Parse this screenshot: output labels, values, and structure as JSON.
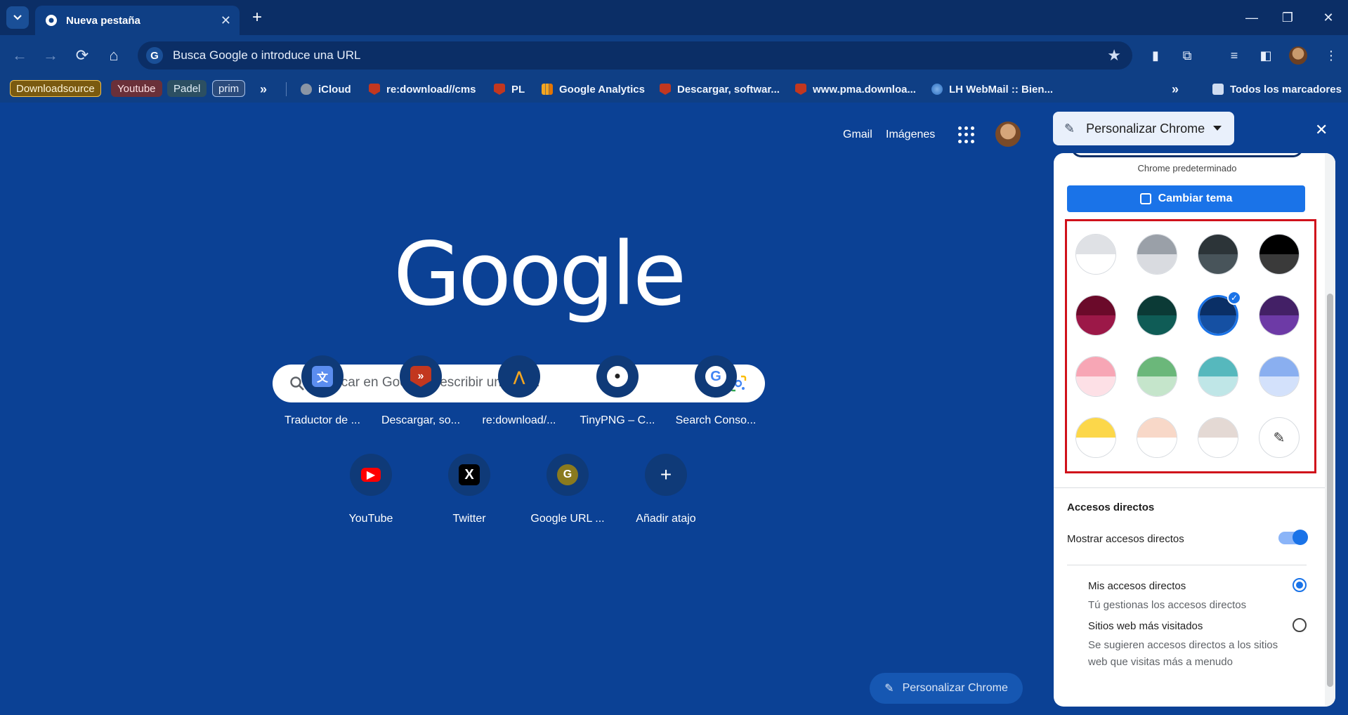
{
  "tab": {
    "title": "Nueva pestaña",
    "close": "✕"
  },
  "window": {
    "minimize": "—",
    "restore": "❐",
    "close": "✕"
  },
  "omnibox": {
    "placeholder": "Busca Google o introduce una URL"
  },
  "bookmarks": {
    "pills": [
      {
        "label": "Downloadsource",
        "bg": "#7a5a10",
        "border": "#f3c24a",
        "color": "#fff6d8"
      },
      {
        "label": "Youtube",
        "bg": "#6a3039",
        "border": "#6a3039",
        "color": "#ffe1e4"
      },
      {
        "label": "Padel",
        "bg": "#2c4f62",
        "border": "#2c4f62",
        "color": "#e1eff7"
      },
      {
        "label": "prim",
        "bg": "#2b4b7c",
        "border": "#a8c1e8",
        "color": "#e6eefb"
      }
    ],
    "items": [
      {
        "label": "iCloud",
        "icon": "apple-icon"
      },
      {
        "label": "re:download//cms",
        "icon": "shield-icon"
      },
      {
        "label": "PL",
        "icon": "shield-icon"
      },
      {
        "label": "Google Analytics",
        "icon": "analytics-icon"
      },
      {
        "label": "Descargar, softwar...",
        "icon": "shield-icon"
      },
      {
        "label": "www.pma.downloa...",
        "icon": "shield-icon"
      },
      {
        "label": "LH WebMail :: Bien...",
        "icon": "globe-icon"
      }
    ],
    "all": "Todos los marcadores"
  },
  "ntp": {
    "gmail": "Gmail",
    "images": "Imágenes",
    "logo": "Google",
    "search_placeholder": "Buscar en Google o escribir una URL",
    "shortcuts": [
      {
        "label": "Traductor de ...",
        "icon": "translate-icon"
      },
      {
        "label": "Descargar, so...",
        "icon": "shield-icon"
      },
      {
        "label": "re:download/...",
        "icon": "rd-icon"
      },
      {
        "label": "TinyPNG – C...",
        "icon": "panda-icon"
      },
      {
        "label": "Search Conso...",
        "icon": "google-icon"
      },
      {
        "label": "YouTube",
        "icon": "youtube-icon"
      },
      {
        "label": "Twitter",
        "icon": "x-icon"
      },
      {
        "label": "Google URL ...",
        "icon": "g-letter-icon",
        "letter": "G"
      },
      {
        "label": "Añadir atajo",
        "icon": "plus-icon"
      }
    ],
    "customize": "Personalizar Chrome"
  },
  "panel": {
    "title": "Personalizar Chrome",
    "default_label": "Chrome predeterminado",
    "change_theme": "Cambiar tema",
    "swatches": [
      {
        "top": "#dfe1e5",
        "bottom": "#ffffff"
      },
      {
        "top": "#9aa0a8",
        "bottom": "#d9dbe0"
      },
      {
        "top": "#2c3438",
        "bottom": "#48545a"
      },
      {
        "top": "#000000",
        "bottom": "#3a3a3a"
      },
      {
        "top": "#6b0a2a",
        "bottom": "#9c1848"
      },
      {
        "top": "#0b3a36",
        "bottom": "#0f5c56"
      },
      {
        "top": "#0a2f66",
        "bottom": "#1550a3",
        "selected": true
      },
      {
        "top": "#432066",
        "bottom": "#6d3aa6"
      },
      {
        "top": "#f7a6b5",
        "bottom": "#fde0e6"
      },
      {
        "top": "#6bb77a",
        "bottom": "#c5e5cb"
      },
      {
        "top": "#56b8bd",
        "bottom": "#bfe6e7"
      },
      {
        "top": "#8aaff0",
        "bottom": "#d3e1fb"
      },
      {
        "top": "#fcd74a",
        "bottom": "#ffffff"
      },
      {
        "top": "#f8d8c8",
        "bottom": "#ffffff"
      },
      {
        "top": "#e4d9d4",
        "bottom": "#ffffff"
      }
    ],
    "shortcuts_title": "Accesos directos",
    "show_shortcuts": "Mostrar accesos directos",
    "my_shortcuts": "Mis accesos directos",
    "my_shortcuts_sub": "Tú gestionas los accesos directos",
    "most_visited": "Sitios web más visitados",
    "most_visited_sub": "Se sugieren accesos directos a los sitios web que visitas más a menudo"
  }
}
